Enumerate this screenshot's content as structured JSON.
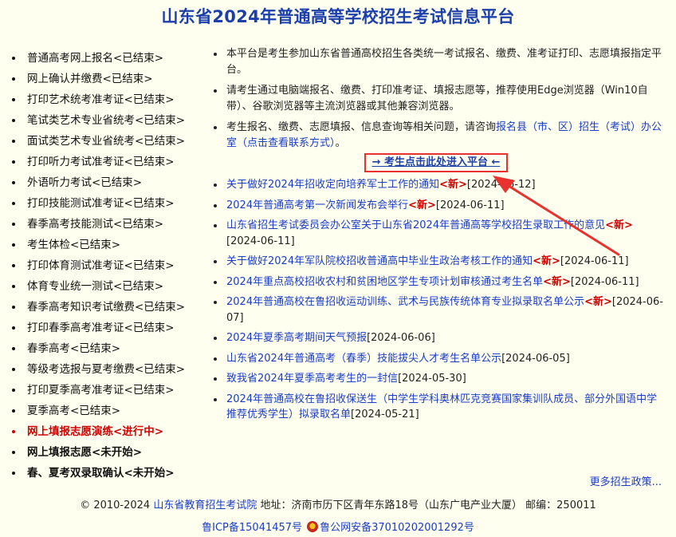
{
  "header": {
    "title": "山东省2024年普通高等学校招生考试信息平台"
  },
  "left_nav": [
    {
      "label": "普通高考网上报名<已结束>",
      "state": "done"
    },
    {
      "label": "网上确认并缴费<已结束>",
      "state": "done"
    },
    {
      "label": "打印艺术统考准考证<已结束>",
      "state": "done"
    },
    {
      "label": "笔试类艺术专业省统考<已结束>",
      "state": "done"
    },
    {
      "label": "面试类艺术专业省统考<已结束>",
      "state": "done"
    },
    {
      "label": "打印听力考试准考证<已结束>",
      "state": "done"
    },
    {
      "label": "外语听力考试<已结束>",
      "state": "done"
    },
    {
      "label": "打印技能测试准考证<已结束>",
      "state": "done"
    },
    {
      "label": "春季高考技能测试<已结束>",
      "state": "done"
    },
    {
      "label": "考生体检<已结束>",
      "state": "done"
    },
    {
      "label": "打印体育测试准考证<已结束>",
      "state": "done"
    },
    {
      "label": "体育专业统一测试<已结束>",
      "state": "done"
    },
    {
      "label": "春季高考知识考试缴费<已结束>",
      "state": "done"
    },
    {
      "label": "打印春季高考准考证<已结束>",
      "state": "done"
    },
    {
      "label": "春季高考<已结束>",
      "state": "done"
    },
    {
      "label": "等级考选报与夏考缴费<已结束>",
      "state": "done"
    },
    {
      "label": "打印夏季高考准考证<已结束>",
      "state": "done"
    },
    {
      "label": "夏季高考<已结束>",
      "state": "done"
    },
    {
      "label": "网上填报志愿演练<进行中>",
      "state": "active"
    },
    {
      "label": "网上填报志愿<未开始>",
      "state": "pending"
    },
    {
      "label": "春、夏考双录取确认<未开始>",
      "state": "pending"
    }
  ],
  "intro": {
    "item1": "本平台是考生参加山东省普通高校招生各类统一考试报名、缴费、准考证打印、志愿填报指定平台。",
    "item2": "请考生通过电脑端报名、缴费、打印准考证、填报志愿等，推荐使用Edge浏览器（Win10自带）、谷歌浏览器等主流浏览器或其他兼容浏览器。",
    "item3_prefix": "考生报名、缴费、志愿填报、信息查询等相关问题，请咨询",
    "item3_link": "报名县（市、区）招生（考试）办公室（点击查看联系方式）",
    "item3_suffix": "。"
  },
  "enter_button": "→ 考生点击此处进入平台 ←",
  "news": [
    {
      "title": "关于做好2024年招收定向培养军士工作的通知",
      "new": "<新>",
      "date": "[2024-06-12]"
    },
    {
      "title": "2024年普通高考第一次新闻发布会举行",
      "new": "<新>",
      "date": "[2024-06-11]"
    },
    {
      "title": "山东省招生考试委员会办公室关于山东省2024年普通高等学校招生录取工作的意见",
      "new": "<新>",
      "date": "[2024-06-11]"
    },
    {
      "title": "关于做好2024年军队院校招收普通高中毕业生政治考核工作的通知",
      "new": "<新>",
      "date": "[2024-06-11]"
    },
    {
      "title": "2024年重点高校招收农村和贫困地区学生专项计划审核通过考生名单",
      "new": "<新>",
      "date": "[2024-06-11]"
    },
    {
      "title": "2024年普通高校在鲁招收运动训练、武术与民族传统体育专业拟录取名单公示",
      "new": "<新>",
      "date": "[2024-06-07]"
    },
    {
      "title": "2024年夏季高考期间天气预报",
      "new": "",
      "date": "[2024-06-06]"
    },
    {
      "title": "山东省2024年普通高考（春季）技能拔尖人才考生名单公示",
      "new": "",
      "date": "[2024-06-05]"
    },
    {
      "title": "致我省2024年夏季高考考生的一封信",
      "new": "",
      "date": "[2024-05-30]"
    },
    {
      "title": "2024年普通高校在鲁招收保送生（中学生学科奥林匹克竞赛国家集训队成员、部分外国语中学推荐优秀学生）拟录取名单",
      "new": "",
      "date": "[2024-05-21]"
    }
  ],
  "more_link": "更多招生政策...",
  "footer": {
    "copyright": "© 2010-2024 ",
    "org": "山东省教育招生考试院",
    "address": " 地址：济南市历下区青年东路18号（山东广电产业大厦） 邮编：250011",
    "icp": "鲁ICP备15041457号",
    "police": "鲁公网安备37010202001292号"
  },
  "colors": {
    "background": "#fffff0",
    "link": "#1a3cc8",
    "title": "#1c3faa",
    "accent_red": "#d30000",
    "arrow": "#e8322e"
  }
}
